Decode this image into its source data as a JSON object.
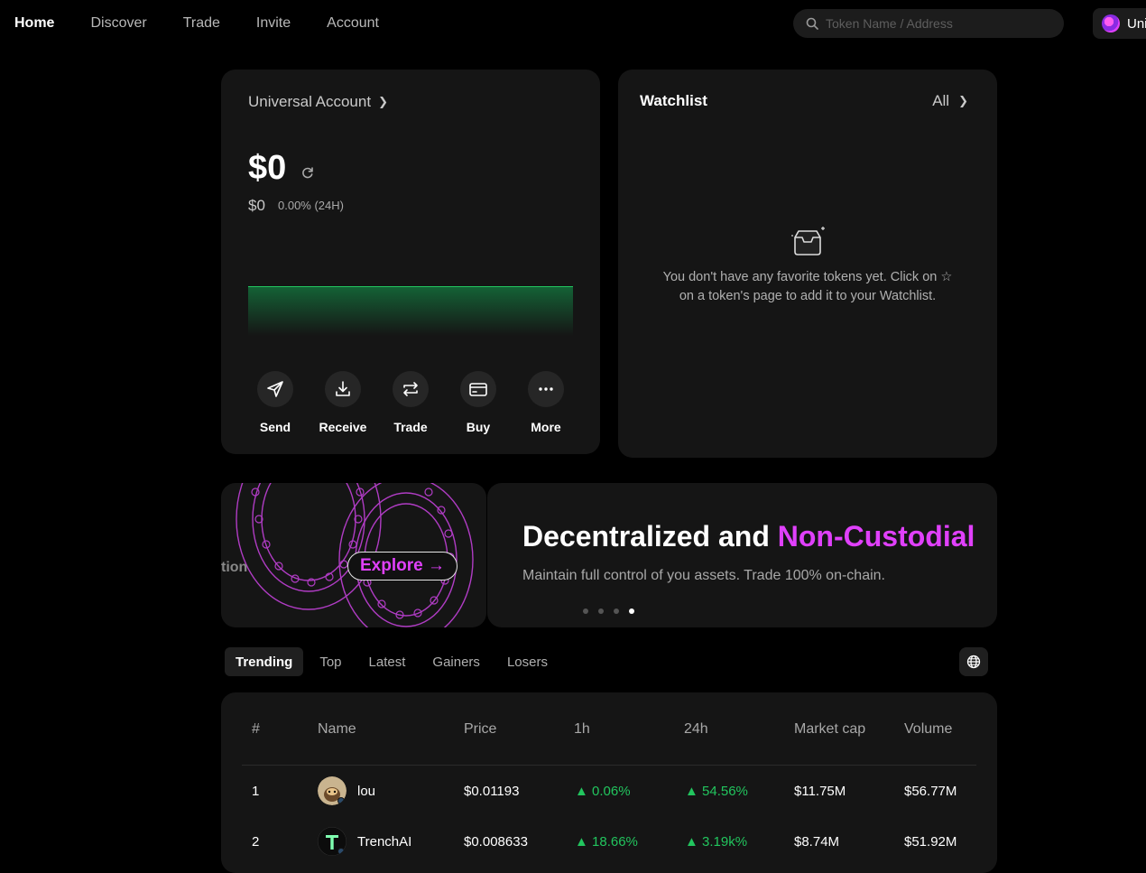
{
  "nav": {
    "links": [
      "Home",
      "Discover",
      "Trade",
      "Invite",
      "Account"
    ],
    "search_placeholder": "Token Name / Address",
    "user_label": "Uni"
  },
  "account": {
    "title": "Universal Account",
    "balance": "$0",
    "sub_balance": "$0",
    "change": "0.00% (24H)",
    "actions": [
      "Send",
      "Receive",
      "Trade",
      "Buy",
      "More"
    ]
  },
  "watchlist": {
    "title": "Watchlist",
    "all_label": "All",
    "empty_text": "You don't have any favorite tokens yet. Click on ☆ on a token's page to add it to your Watchlist."
  },
  "promo": {
    "left_partial_text": "tion",
    "explore_label": "Explore →",
    "headline_plain": "Decentralized and ",
    "headline_highlight": "Non-Custodial",
    "subtext": "Maintain full control of you assets. Trade 100% on-chain.",
    "slide_count": 4,
    "active_slide": 4
  },
  "market": {
    "tabs": [
      "Trending",
      "Top",
      "Latest",
      "Gainers",
      "Losers"
    ],
    "active_tab": "Trending",
    "columns": [
      "#",
      "Name",
      "Price",
      "1h",
      "24h",
      "Market cap",
      "Volume"
    ],
    "rows": [
      {
        "rank": "1",
        "name": "lou",
        "price": "$0.01193",
        "h1": "0.06%",
        "h24": "54.56%",
        "mcap": "$11.75M",
        "volume": "$56.77M"
      },
      {
        "rank": "2",
        "name": "TrenchAI",
        "price": "$0.008633",
        "h1": "18.66%",
        "h24": "3.19k%",
        "mcap": "$8.74M",
        "volume": "$51.92M"
      }
    ]
  },
  "colors": {
    "accent": "#e040fb",
    "up": "#22c55e",
    "card": "#151515",
    "background": "#000000"
  }
}
